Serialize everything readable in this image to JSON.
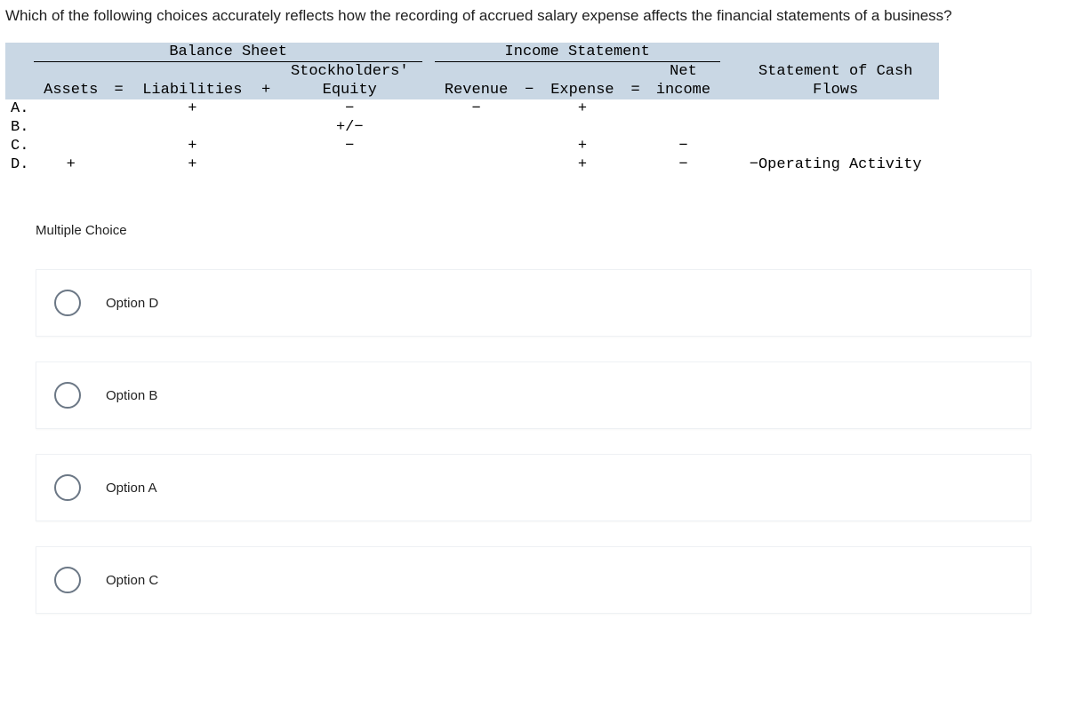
{
  "question": "Which of the following choices accurately reflects how the recording of accrued salary expense affects the financial statements of a business?",
  "table": {
    "group_headers": {
      "balance_sheet": "Balance Sheet",
      "income_statement": "Income Statement"
    },
    "col_line2": {
      "stockholders": "Stockholders'",
      "net": "Net",
      "cashflow": "Statement of Cash"
    },
    "col_line3": {
      "assets": "Assets",
      "eq1": "=",
      "liab": "Liabilities",
      "plus1": "+",
      "equity": "Equity",
      "revenue": "Revenue",
      "minus1": "−",
      "expense": "Expense",
      "eq2": "=",
      "netincome": "income",
      "flows": "Flows"
    },
    "rows": [
      {
        "label": "A.",
        "assets": "",
        "liab": "+",
        "equity": "−",
        "revenue": "−",
        "expense": "+",
        "net": "",
        "cash": ""
      },
      {
        "label": "B.",
        "assets": "",
        "liab": "",
        "equity": "+/−",
        "revenue": "",
        "expense": "",
        "net": "",
        "cash": ""
      },
      {
        "label": "C.",
        "assets": "",
        "liab": "+",
        "equity": "−",
        "revenue": "",
        "expense": "+",
        "net": "−",
        "cash": ""
      },
      {
        "label": "D.",
        "assets": "+",
        "liab": "+",
        "equity": "",
        "revenue": "",
        "expense": "+",
        "net": "−",
        "cash": "−Operating Activity"
      }
    ]
  },
  "mc_label": "Multiple Choice",
  "options": [
    {
      "label": "Option D"
    },
    {
      "label": "Option B"
    },
    {
      "label": "Option A"
    },
    {
      "label": "Option C"
    }
  ]
}
